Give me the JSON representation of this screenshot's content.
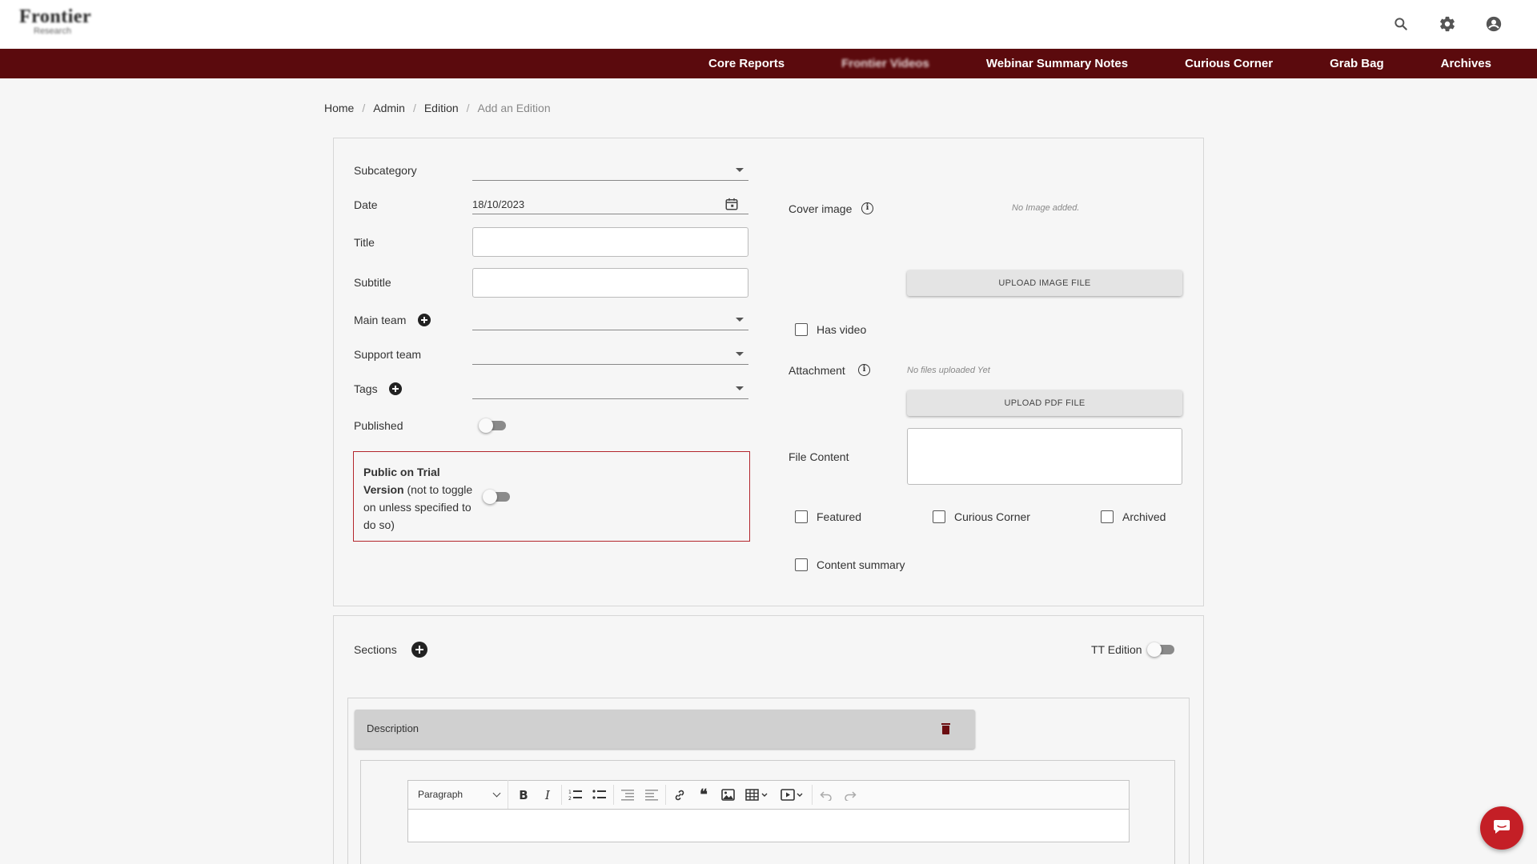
{
  "header": {
    "logo_line1": "Frontier",
    "logo_line2": "Research",
    "icons": [
      "search-icon",
      "gear-icon",
      "account-circle-icon"
    ]
  },
  "nav": {
    "items": [
      "Core Reports",
      "Frontier Videos",
      "Webinar Summary Notes",
      "Curious Corner",
      "Grab Bag",
      "Archives"
    ]
  },
  "breadcrumb": [
    "Home",
    "Admin",
    "Edition",
    "Add an Edition"
  ],
  "form": {
    "subcategory_label": "Subcategory",
    "date_label": "Date",
    "date_value": "18/10/2023",
    "title_label": "Title",
    "subtitle_label": "Subtitle",
    "main_team_label": "Main team",
    "support_team_label": "Support team",
    "tags_label": "Tags",
    "published_label": "Published",
    "published_on": false,
    "trial_bold": "Public on Trial Version",
    "trial_note": "(not to toggle on unless specified to do so)",
    "trial_on": false,
    "cover_image_label": "Cover image",
    "no_image_text": "No Image added.",
    "upload_image_label": "UPLOAD IMAGE FILE",
    "has_video_label": "Has video",
    "attachment_label": "Attachment",
    "no_files_text": "No files uploaded Yet",
    "upload_pdf_label": "UPLOAD PDF FILE",
    "file_content_label": "File Content",
    "featured_label": "Featured",
    "curious_corner_label": "Curious Corner",
    "archived_label": "Archived",
    "content_summary_label": "Content summary"
  },
  "sections": {
    "label": "Sections",
    "tt_edition_label": "TT Edition",
    "tt_edition_on": false,
    "description_title": "Description",
    "editor": {
      "block_format": "Paragraph",
      "tools": [
        "bold-icon",
        "italic-icon",
        "numbered-list-icon",
        "bulleted-list-icon",
        "outdent-icon",
        "indent-icon",
        "link-icon",
        "blockquote-icon",
        "image-icon",
        "table-icon",
        "media-embed-icon",
        "undo-icon",
        "redo-icon"
      ]
    }
  },
  "colors": {
    "nav_bg": "#5b0a0d",
    "accent_red": "#b3262c",
    "chat_button": "#c41f26"
  }
}
